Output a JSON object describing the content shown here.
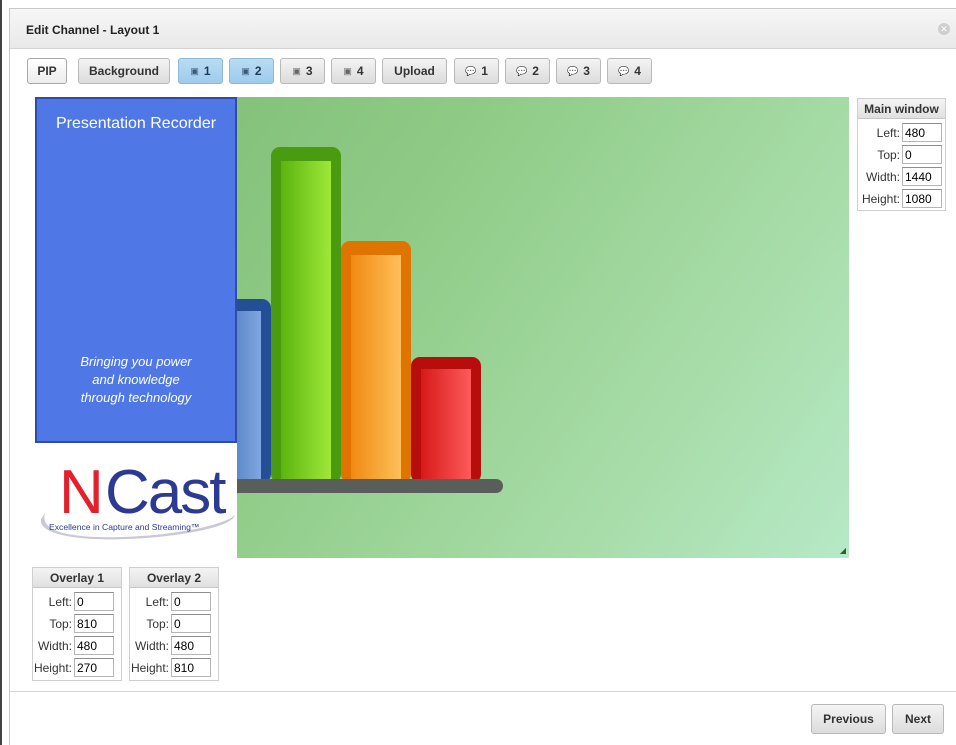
{
  "dialog": {
    "title": "Edit Channel - Layout 1",
    "close_icon": "close-icon"
  },
  "toolbar": {
    "pip": "PIP",
    "background": "Background",
    "image_slots": [
      "1",
      "2",
      "3",
      "4"
    ],
    "upload": "Upload",
    "text_slots": [
      "1",
      "2",
      "3",
      "4"
    ],
    "active_image_slots": [
      "1",
      "2"
    ],
    "image_icon": "image-icon",
    "text_icon": "text-icon"
  },
  "preview": {
    "overlay1": {
      "title": "Presentation Recorder",
      "tagline": "Bringing you power and knowledge through technology"
    },
    "overlay2": {
      "logo_text": "NCast",
      "logo_tagline": "Excellence in Capture and Streaming™"
    },
    "main_window_content": "bar-chart-image",
    "colors": {
      "overlay_blue": "#4f78e6",
      "background_green": "#8fcb86",
      "logo_red": "#e3202b"
    }
  },
  "panels": {
    "main_window": {
      "title": "Main window",
      "left": "480",
      "top": "0",
      "width": "1440",
      "height": "1080"
    },
    "overlay1": {
      "title": "Overlay 1",
      "left": "0",
      "top": "810",
      "width": "480",
      "height": "270"
    },
    "overlay2": {
      "title": "Overlay 2",
      "left": "0",
      "top": "0",
      "width": "480",
      "height": "810"
    },
    "labels": {
      "left": "Left:",
      "top": "Top:",
      "width": "Width:",
      "height": "Height:"
    }
  },
  "footer": {
    "previous": "Previous",
    "next": "Next"
  }
}
